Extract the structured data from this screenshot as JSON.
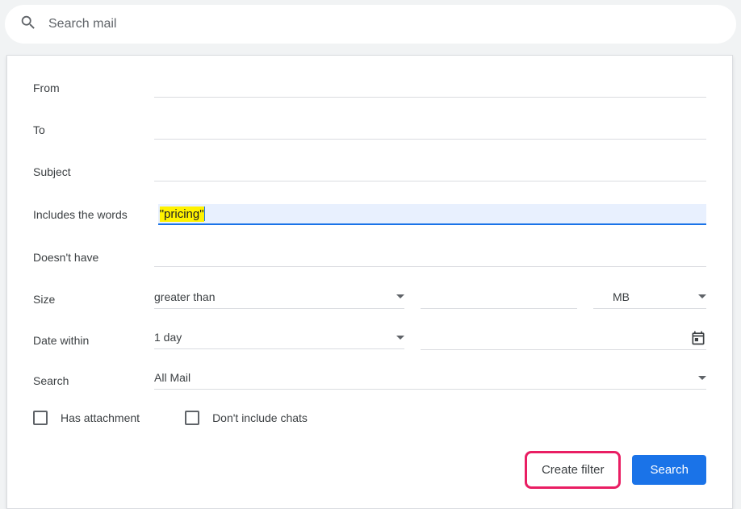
{
  "searchBar": {
    "placeholder": "Search mail"
  },
  "filterForm": {
    "from": {
      "label": "From",
      "value": ""
    },
    "to": {
      "label": "To",
      "value": ""
    },
    "subject": {
      "label": "Subject",
      "value": ""
    },
    "includesWords": {
      "label": "Includes the words",
      "value": "\"pricing\""
    },
    "doesntHave": {
      "label": "Doesn't have",
      "value": ""
    },
    "size": {
      "label": "Size",
      "comparator": "greater than",
      "amount": "",
      "unit": "MB"
    },
    "dateWithin": {
      "label": "Date within",
      "range": "1 day",
      "date": ""
    },
    "searchIn": {
      "label": "Search",
      "value": "All Mail"
    },
    "hasAttachment": {
      "label": "Has attachment",
      "checked": false
    },
    "dontIncludeChats": {
      "label": "Don't include chats",
      "checked": false
    },
    "buttons": {
      "createFilter": "Create filter",
      "search": "Search"
    }
  }
}
